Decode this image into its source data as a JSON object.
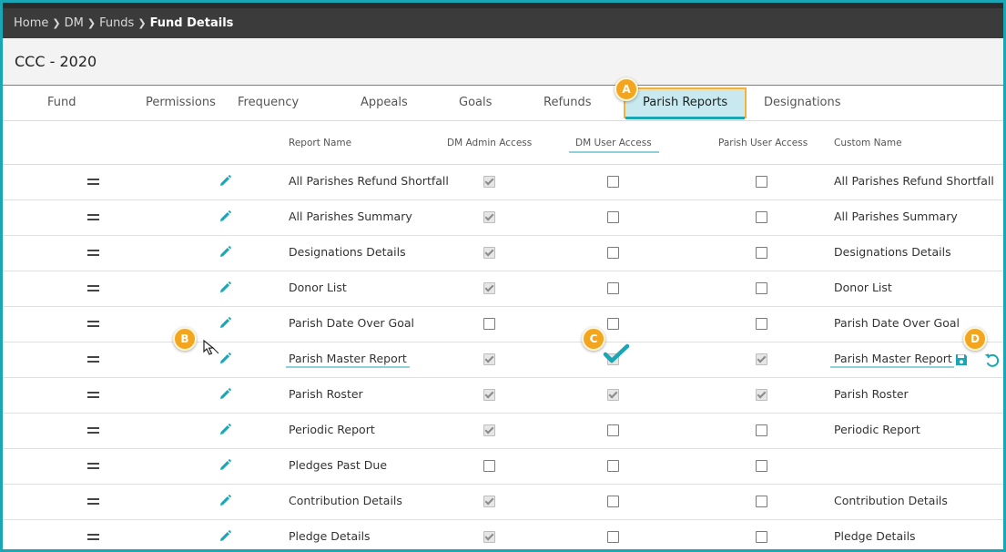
{
  "breadcrumb": [
    "Home",
    "DM",
    "Funds",
    "Fund Details"
  ],
  "page_title": "CCC - 2020",
  "tabs": [
    "Fund",
    "Permissions",
    "Frequency",
    "Appeals",
    "Goals",
    "Refunds",
    "Parish Reports",
    "Designations"
  ],
  "active_tab": "Parish Reports",
  "callouts": [
    "A",
    "B",
    "C",
    "D"
  ],
  "columns": {
    "report_name": "Report Name",
    "dm_admin": "DM Admin Access",
    "dm_user": "DM User Access",
    "parish_user": "Parish User Access",
    "custom_name": "Custom Name"
  },
  "rows": [
    {
      "name": "All Parishes Refund Shortfall",
      "dm_admin": true,
      "dm_user": false,
      "parish_user": false,
      "custom": "All Parishes Refund Shortfall"
    },
    {
      "name": "All Parishes Summary",
      "dm_admin": true,
      "dm_user": false,
      "parish_user": false,
      "custom": "All Parishes Summary"
    },
    {
      "name": "Designations Details",
      "dm_admin": true,
      "dm_user": false,
      "parish_user": false,
      "custom": "Designations Details"
    },
    {
      "name": "Donor List",
      "dm_admin": true,
      "dm_user": false,
      "parish_user": false,
      "custom": "Donor List"
    },
    {
      "name": "Parish Date Over Goal",
      "dm_admin": false,
      "dm_user": false,
      "parish_user": false,
      "custom": "Parish Date Over Goal"
    },
    {
      "name": "Parish Master Report",
      "dm_admin": true,
      "dm_user": true,
      "parish_user": true,
      "custom": "Parish Master Report",
      "editing": true
    },
    {
      "name": "Parish Roster",
      "dm_admin": true,
      "dm_user": true,
      "parish_user": true,
      "custom": "Parish Roster"
    },
    {
      "name": "Periodic Report",
      "dm_admin": true,
      "dm_user": false,
      "parish_user": false,
      "custom": "Periodic Report"
    },
    {
      "name": "Pledges Past Due",
      "dm_admin": false,
      "dm_user": false,
      "parish_user": false,
      "custom": ""
    },
    {
      "name": "Contribution Details",
      "dm_admin": true,
      "dm_user": false,
      "parish_user": false,
      "custom": "Contribution Details"
    },
    {
      "name": "Pledge Details",
      "dm_admin": true,
      "dm_user": false,
      "parish_user": false,
      "custom": "Pledge Details"
    }
  ],
  "colors": {
    "accent": "#1aa7b5",
    "callout": "#f3a520",
    "active_tab_bg": "#c7e9ef",
    "header_bar": "#3b3b3b"
  },
  "icons": [
    "drag-handle-icon",
    "pencil-icon",
    "save-icon",
    "undo-icon",
    "pointer-cursor-icon",
    "checkmark-icon"
  ]
}
